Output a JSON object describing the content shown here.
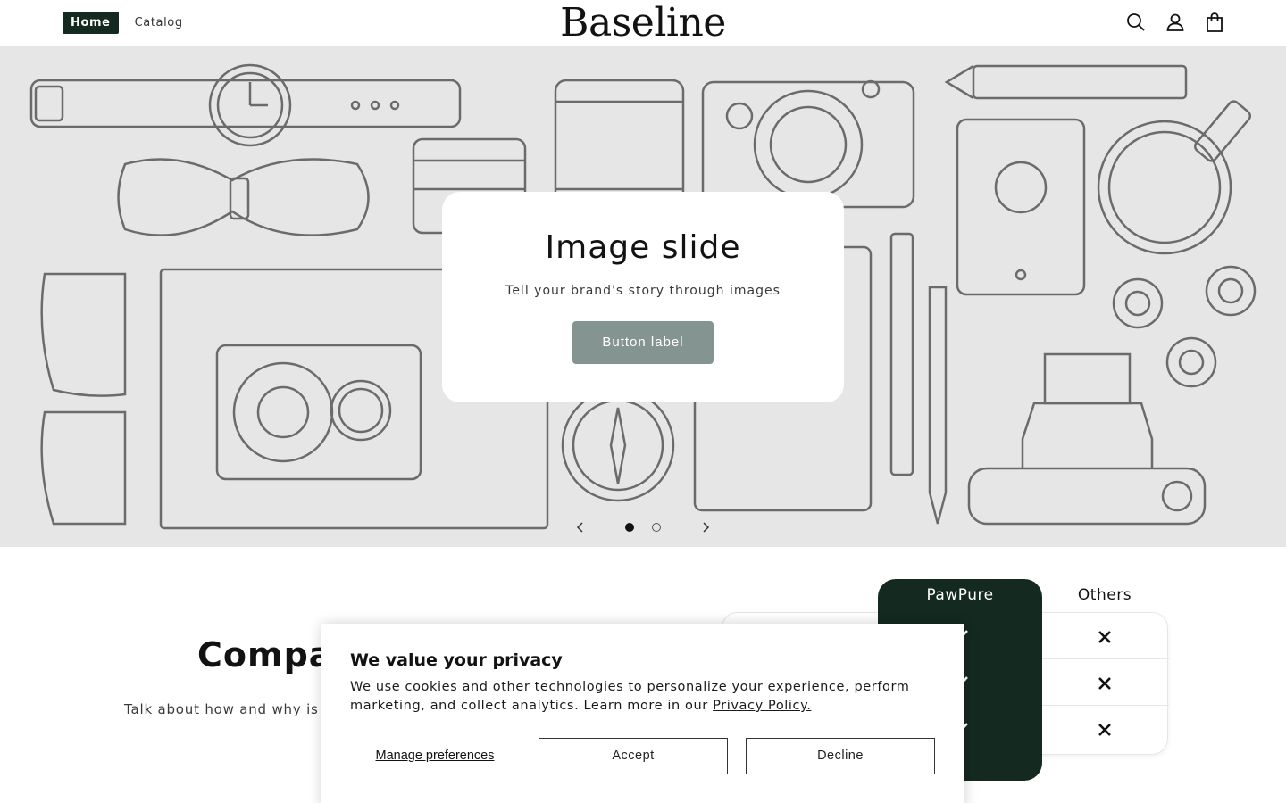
{
  "header": {
    "nav": [
      {
        "label": "Home",
        "active": true
      },
      {
        "label": "Catalog",
        "active": false
      }
    ],
    "logo": "Baseline",
    "icons": [
      "search-icon",
      "account-icon",
      "cart-icon"
    ]
  },
  "hero": {
    "title": "Image slide",
    "subtitle": "Tell your brand's story through images",
    "button_label": "Button label",
    "slides_total": 2,
    "current_slide": 1,
    "prev_icon": "chevron-left-icon",
    "next_icon": "chevron-right-icon"
  },
  "comparison": {
    "title": "Compar",
    "text": "Talk about how and why is y",
    "brand_column": "PawPure",
    "others_column": "Others",
    "rows": [
      {
        "brand": "check",
        "others": "x"
      },
      {
        "brand": "check",
        "others": "x"
      },
      {
        "brand": "check",
        "others": "x"
      }
    ]
  },
  "cookie_banner": {
    "title": "We value your privacy",
    "text": "We use cookies and other technologies to personalize your experience, perform marketing, and collect analytics. Learn more in our ",
    "link_label": "Privacy Policy.",
    "manage_label": "Manage preferences",
    "accept_label": "Accept",
    "decline_label": "Decline"
  },
  "colors": {
    "brand_dark": "#14291f",
    "hero_bg": "#e6e6e6",
    "hero_button": "#849490"
  }
}
